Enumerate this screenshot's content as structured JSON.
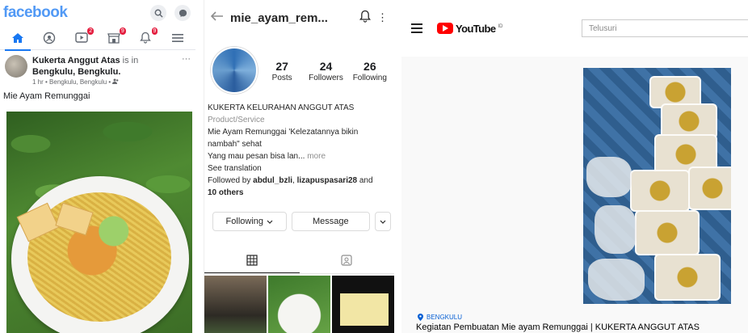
{
  "facebook": {
    "logo": "facebook",
    "nav_badges": [
      "",
      "",
      "2",
      "9",
      "9",
      ""
    ],
    "post": {
      "author": "Kukerta Anggut Atas",
      "is_in": "is in",
      "location": "Bengkulu, Bengkulu.",
      "meta": "1 hr • Bengkulu, Bengkulu • ",
      "caption": "Mie Ayam Remunggai"
    },
    "colors": {
      "brand": "#1877f2",
      "badge": "#e41e3f"
    }
  },
  "instagram": {
    "username": "mie_ayam_rem...",
    "stats": [
      {
        "value": "27",
        "label": "Posts"
      },
      {
        "value": "24",
        "label": "Followers"
      },
      {
        "value": "26",
        "label": "Following"
      }
    ],
    "bio": {
      "name": "KUKERTA KELURAHAN ANGGUT ATAS",
      "category": "Product/Service",
      "line1": "Mie Ayam Remunggai 'Kelezatannya bikin",
      "line2": "nambah\" sehat",
      "line3": "Yang mau pesan bisa lan...",
      "more": " more",
      "translation": "See translation",
      "followed_by_prefix": "Followed by ",
      "follower1": "abdul_bzli",
      "sep": ", ",
      "follower2": "lizapuspasari28",
      "and": " and",
      "others": "10 others"
    },
    "buttons": {
      "following": "Following",
      "message": "Message"
    }
  },
  "youtube": {
    "logo_text": "YouTube",
    "country": "ID",
    "search_placeholder": "Telusuri",
    "location": "BENGKULU",
    "video_title": "Kegiatan Pembuatan Mie ayam Remunggai | KUKERTA ANGGUT ATAS",
    "colors": {
      "brand": "#ff0000",
      "link": "#065fd4"
    }
  },
  "icons": [
    "search-icon",
    "messenger-icon",
    "home-icon",
    "groups-icon",
    "video-icon",
    "marketplace-icon",
    "notifications-icon",
    "menu-icon",
    "back-arrow-icon",
    "bell-icon",
    "chevron-down-icon",
    "grid-icon",
    "tagged-icon",
    "hamburger-icon",
    "location-pin-icon"
  ]
}
